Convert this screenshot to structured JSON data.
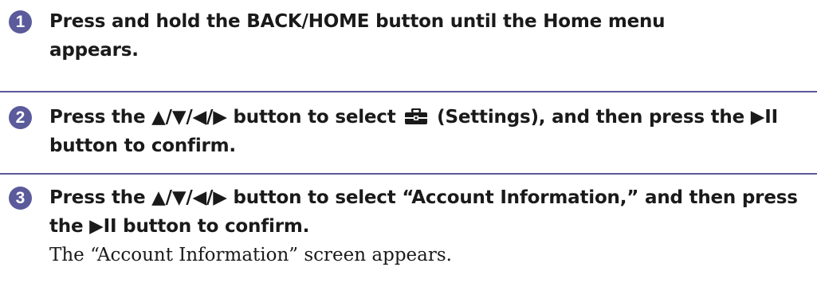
{
  "steps": [
    {
      "number": "1",
      "text": "Press and hold the BACK/HOME button until the Home menu appears."
    },
    {
      "number": "2",
      "text_before": "Press the ▲/▼/◀/▶ button to select",
      "icon": "settings-toolbox-icon",
      "text_after": "(Settings), and then press the ▶II button to confirm."
    },
    {
      "number": "3",
      "text": "Press the ▲/▼/◀/▶ button to select “Account Information,” and then press the ▶II button to confirm.",
      "result": "The “Account Information” screen appears."
    }
  ],
  "colors": {
    "accent": "#5b5a9b",
    "text": "#1a1a1a"
  }
}
